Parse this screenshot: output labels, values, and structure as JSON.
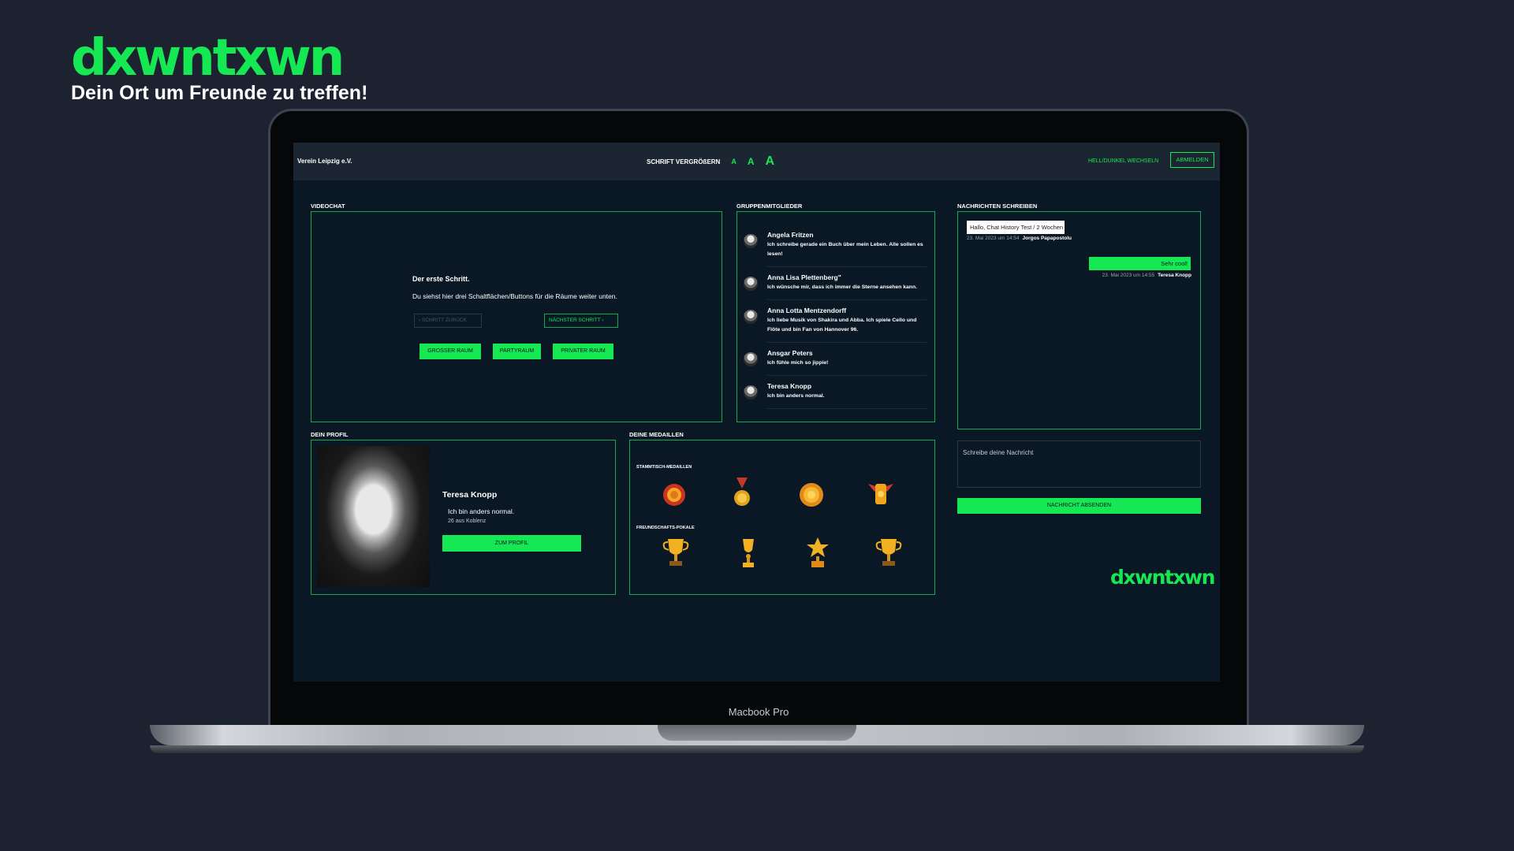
{
  "brand": {
    "logo": "dxwntxwn",
    "tagline": "Dein Ort um Freunde zu treffen!"
  },
  "device": {
    "label": "Macbook Pro"
  },
  "topbar": {
    "org_name": "Verein Leipzig e.V.",
    "font_size_label": "SCHRIFT VERGRÖßERN",
    "font_sizes": [
      "A",
      "A",
      "A"
    ],
    "theme_toggle": "HELL/DUNKEL WECHSELN",
    "logout": "ABMELDEN"
  },
  "videochat": {
    "label": "VIDEOCHAT",
    "title": "Der erste Schritt.",
    "description": "Du siehst hier drei Schaltflächen/Buttons für die Räume weiter unten.",
    "back_step": "SCHRITT ZURÜCK",
    "next_step": "NÄCHSTER SCHRITT",
    "rooms": [
      "GROSSER RAUM",
      "PARTYRAUM",
      "PRIVATER RAUM"
    ]
  },
  "members": {
    "label": "GRUPPENMITGLIEDER",
    "items": [
      {
        "name": "Angela Fritzen",
        "text": "Ich schreibe gerade ein Buch über mein Leben. Alle sollen es lesen!"
      },
      {
        "name": "Anna Lisa Plettenberg\"",
        "text": "Ich wünsche mir, dass ich immer die Sterne ansehen kann."
      },
      {
        "name": "Anna Lotta Mentzendorff",
        "text": "Ich liebe Musik von Shakira und Abba. Ich spiele Cello und Flöte und bin Fan von Hannover 96."
      },
      {
        "name": "Ansgar Peters",
        "text": "Ich fühle mich so jippie!"
      },
      {
        "name": "Teresa Knopp",
        "text": "Ich bin anders normal."
      }
    ]
  },
  "chat": {
    "label": "NACHRICHTEN SCHREIBEN",
    "incoming": {
      "text": "Hallo, Chat History Test / 2 Wochen",
      "date": "23. Mai 2023 um 14:54",
      "author": "Jorgos Papapostolu"
    },
    "outgoing": {
      "text": "Sehr cool!",
      "date": "23. Mai 2023 um 14:55",
      "author": "Teresa Knopp"
    },
    "placeholder": "Schreibe deine Nachricht",
    "send": "NACHRICHT ABSENDEN",
    "logo": "dxwntxwn"
  },
  "profile": {
    "label": "DEIN PROFIL",
    "name": "Teresa Knopp",
    "bio": "Ich bin anders normal.",
    "location": "26 aus Koblenz",
    "button": "ZUM PROFIL"
  },
  "medals": {
    "label": "DEINE MEDAILLEN",
    "stammtisch_label": "STAMMTISCH-MEDAILLEN",
    "freundschaft_label": "FREUNDSCHAFTS-POKALE",
    "stammtisch_icons": [
      "red-medal-icon",
      "ribbon-medal-icon",
      "gold-medal-icon",
      "winged-medal-icon"
    ],
    "freundschaft_icons": [
      "cup-trophy-icon",
      "tall-trophy-icon",
      "star-trophy-icon",
      "cup-trophy-icon"
    ]
  },
  "colors": {
    "accent": "#16e853",
    "background": "#1c2230",
    "app_bg": "#0a1724",
    "topbar": "#1b2632"
  }
}
